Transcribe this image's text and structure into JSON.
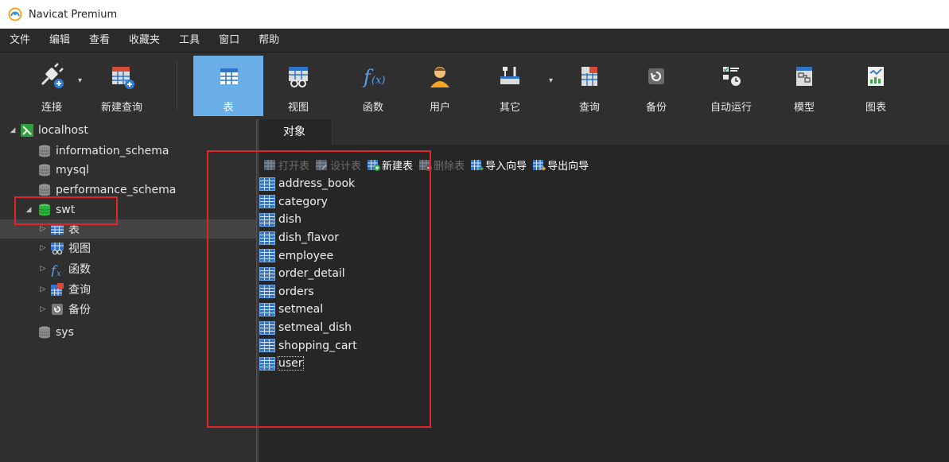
{
  "window": {
    "title": "Navicat Premium"
  },
  "menu": [
    "文件",
    "编辑",
    "查看",
    "收藏夹",
    "工具",
    "窗口",
    "帮助"
  ],
  "toolbar": [
    {
      "label": "连接",
      "icon": "plug-icon"
    },
    {
      "label": "新建查询",
      "icon": "new-query-icon"
    },
    {
      "label": "表",
      "icon": "table-icon",
      "active": true
    },
    {
      "label": "视图",
      "icon": "view-icon"
    },
    {
      "label": "函数",
      "icon": "function-icon"
    },
    {
      "label": "用户",
      "icon": "user-icon"
    },
    {
      "label": "其它",
      "icon": "tools-icon"
    },
    {
      "label": "查询",
      "icon": "query-icon"
    },
    {
      "label": "备份",
      "icon": "backup-icon"
    },
    {
      "label": "自动运行",
      "icon": "schedule-icon"
    },
    {
      "label": "模型",
      "icon": "model-icon"
    },
    {
      "label": "图表",
      "icon": "chart-icon"
    }
  ],
  "navigator": {
    "connection": "localhost",
    "databases": [
      "information_schema",
      "mysql",
      "performance_schema",
      "swt",
      "sys"
    ],
    "swt_children": [
      "表",
      "视图",
      "函数",
      "查询",
      "备份"
    ]
  },
  "tab": {
    "label": "对象"
  },
  "object_toolbar": {
    "open_table": "打开表",
    "design_table": "设计表",
    "new_table": "新建表",
    "delete_table": "删除表",
    "import_wizard": "导入向导",
    "export_wizard": "导出向导"
  },
  "tables": [
    "address_book",
    "category",
    "dish",
    "dish_flavor",
    "employee",
    "order_detail",
    "orders",
    "setmeal",
    "setmeal_dish",
    "shopping_cart",
    "user"
  ],
  "colors": {
    "accent": "#6aaee8",
    "highlight": "#e0242c",
    "table_icon": "#2f74c8"
  }
}
